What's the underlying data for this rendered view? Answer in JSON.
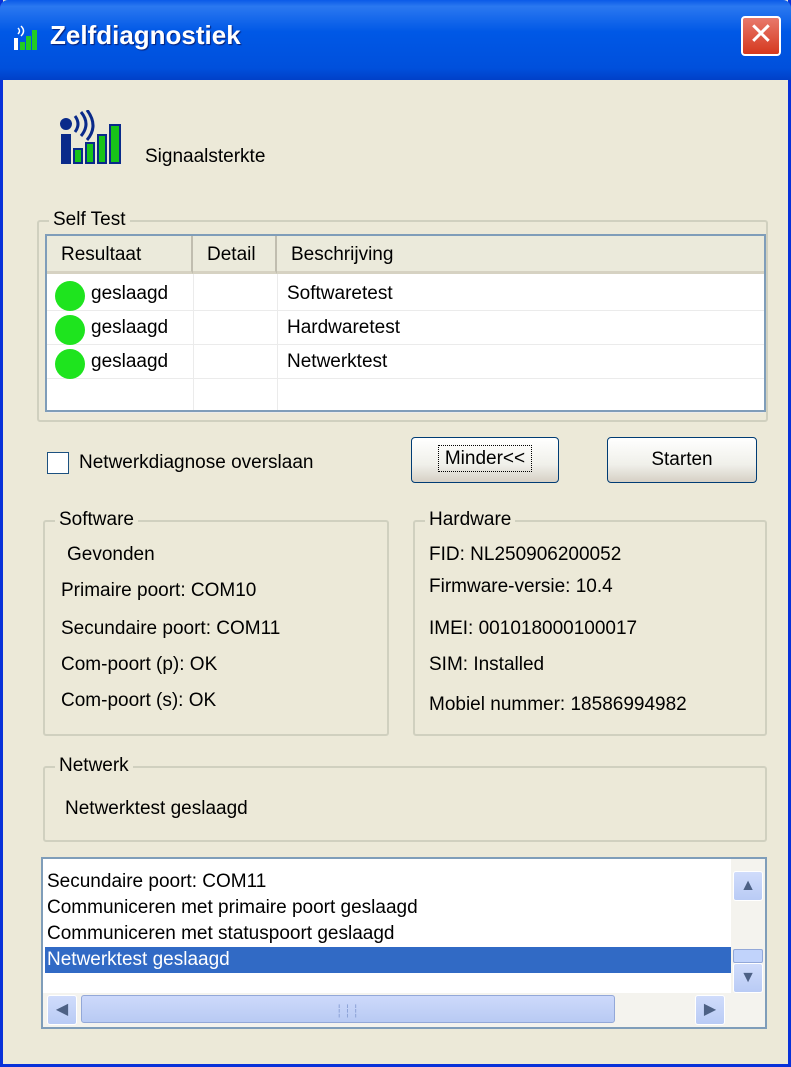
{
  "window": {
    "title": "Zelfdiagnostiek",
    "close_glyph": "✕"
  },
  "header": {
    "signal_label": "Signaalsterkte",
    "icon": "signal-strength-icon"
  },
  "self_test": {
    "legend": "Self Test",
    "columns": [
      "Resultaat",
      "Detail",
      "Beschrijving"
    ],
    "rows": [
      {
        "result": "geslaagd",
        "detail": "",
        "description": "Softwaretest",
        "status_color": "#1ee41e"
      },
      {
        "result": "geslaagd",
        "detail": "",
        "description": "Hardwaretest",
        "status_color": "#1ee41e"
      },
      {
        "result": "geslaagd",
        "detail": "",
        "description": "Netwerktest",
        "status_color": "#1ee41e"
      }
    ]
  },
  "controls": {
    "skip_network_label": "Netwerkdiagnose overslaan",
    "skip_network_checked": false,
    "less_button": "Minder<<",
    "start_button": "Starten"
  },
  "software": {
    "legend": "Software",
    "status": "Gevonden",
    "primary_port": "Primaire poort: COM10",
    "secondary_port": "Secundaire poort: COM11",
    "com_p": "Com-poort (p): OK",
    "com_s": "Com-poort (s): OK"
  },
  "hardware": {
    "legend": "Hardware",
    "fid": "FID: NL250906200052",
    "firmware": "Firmware-versie: 10.4",
    "imei": "IMEI: 001018000100017",
    "sim": "SIM: Installed",
    "mobile": "Mobiel nummer: 18586994982"
  },
  "network": {
    "legend": "Netwerk",
    "status": "Netwerktest geslaagd"
  },
  "log": {
    "lines": [
      "Secundaire poort: COM11",
      "Communiceren met primaire poort geslaagd",
      "Communiceren met statuspoort geslaagd",
      "Netwerktest geslaagd"
    ],
    "selected_index": 3
  },
  "colors": {
    "titlebar": "#0058e6",
    "selection": "#316ac5",
    "pass": "#1ee41e"
  }
}
